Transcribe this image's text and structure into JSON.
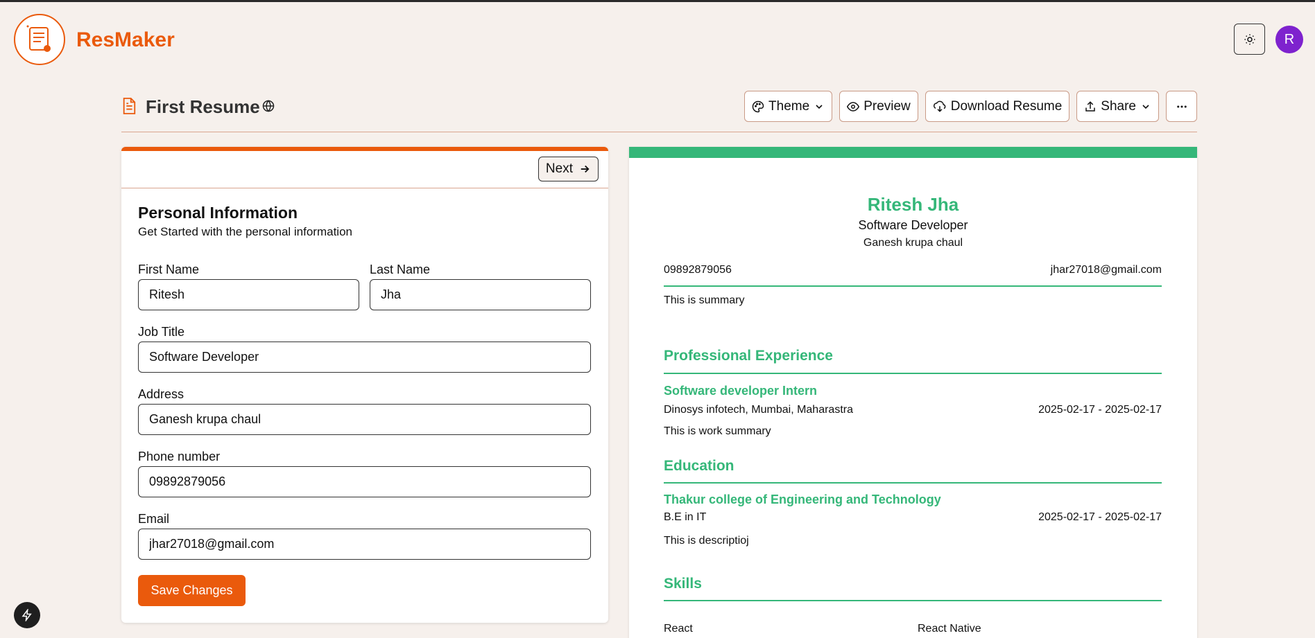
{
  "app": {
    "brand": "ResMaker",
    "avatar_initial": "R"
  },
  "resume": {
    "title": "First Resume"
  },
  "toolbar": {
    "theme_label": "Theme",
    "preview_label": "Preview",
    "download_label": "Download Resume",
    "share_label": "Share"
  },
  "form": {
    "next_label": "Next",
    "heading": "Personal Information",
    "subheading": "Get Started with the personal information",
    "first_name_label": "First Name",
    "first_name_value": "Ritesh",
    "last_name_label": "Last Name",
    "last_name_value": "Jha",
    "job_title_label": "Job Title",
    "job_title_value": "Software Developer",
    "address_label": "Address",
    "address_value": "Ganesh krupa chaul",
    "phone_label": "Phone number",
    "phone_value": "09892879056",
    "email_label": "Email",
    "email_value": "jhar27018@gmail.com",
    "save_label": "Save Changes"
  },
  "preview": {
    "name": "Ritesh Jha",
    "job_title": "Software Developer",
    "address": "Ganesh krupa chaul",
    "phone": "09892879056",
    "email": "jhar27018@gmail.com",
    "summary": "This is summary",
    "experience_heading": "Professional Experience",
    "experience": {
      "title": "Software developer Intern",
      "company": "Dinosys infotech, Mumbai, Maharastra",
      "dates": "2025-02-17 - 2025-02-17",
      "summary": "This is work summary"
    },
    "education_heading": "Education",
    "education": {
      "school": "Thakur college of Engineering and Technology",
      "degree": "B.E in IT",
      "dates": "2025-02-17 - 2025-02-17",
      "description": "This is descriptioj"
    },
    "skills_heading": "Skills",
    "skills": [
      "React",
      "React Native"
    ]
  },
  "colors": {
    "accent": "#ea5a0c",
    "resume_theme": "#35b779",
    "avatar": "#7e22ce"
  }
}
